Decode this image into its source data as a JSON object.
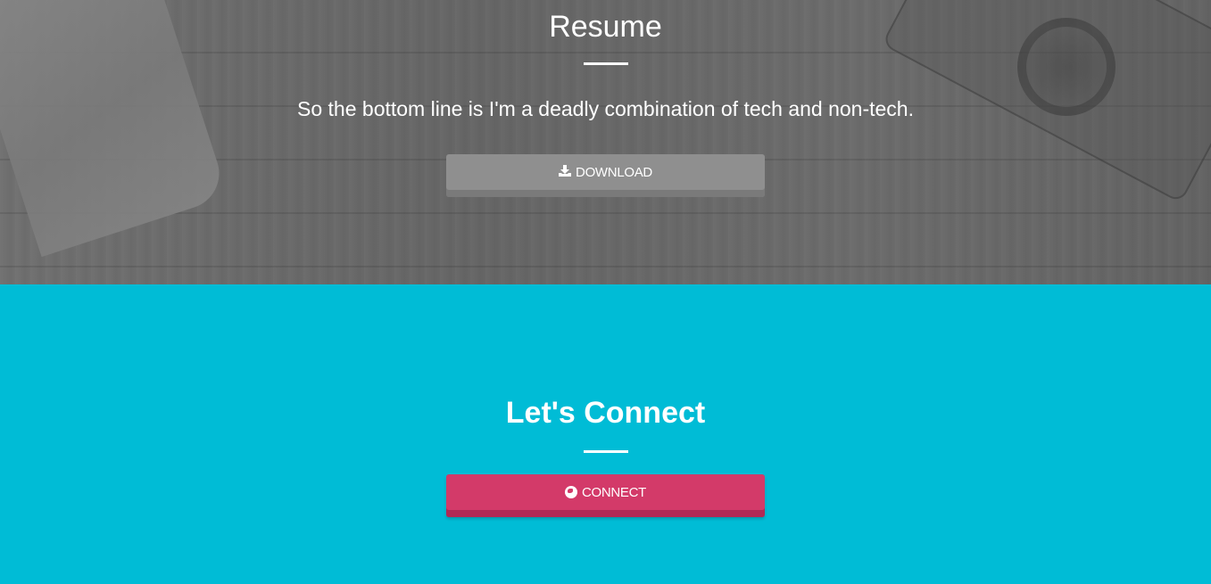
{
  "resume": {
    "title": "Resume",
    "text": "So the bottom line is I'm a deadly combination of tech and non-tech.",
    "download_label": "DOWNLOAD",
    "download_icon": "download-icon",
    "background_color": "#6a6a6a",
    "button_color": "#8f8f8f"
  },
  "connect": {
    "title": "Let's Connect",
    "button_label": "CONNECT",
    "button_icon": "globe-icon",
    "background_color": "#00bcd6",
    "button_color": "#d33a69"
  }
}
